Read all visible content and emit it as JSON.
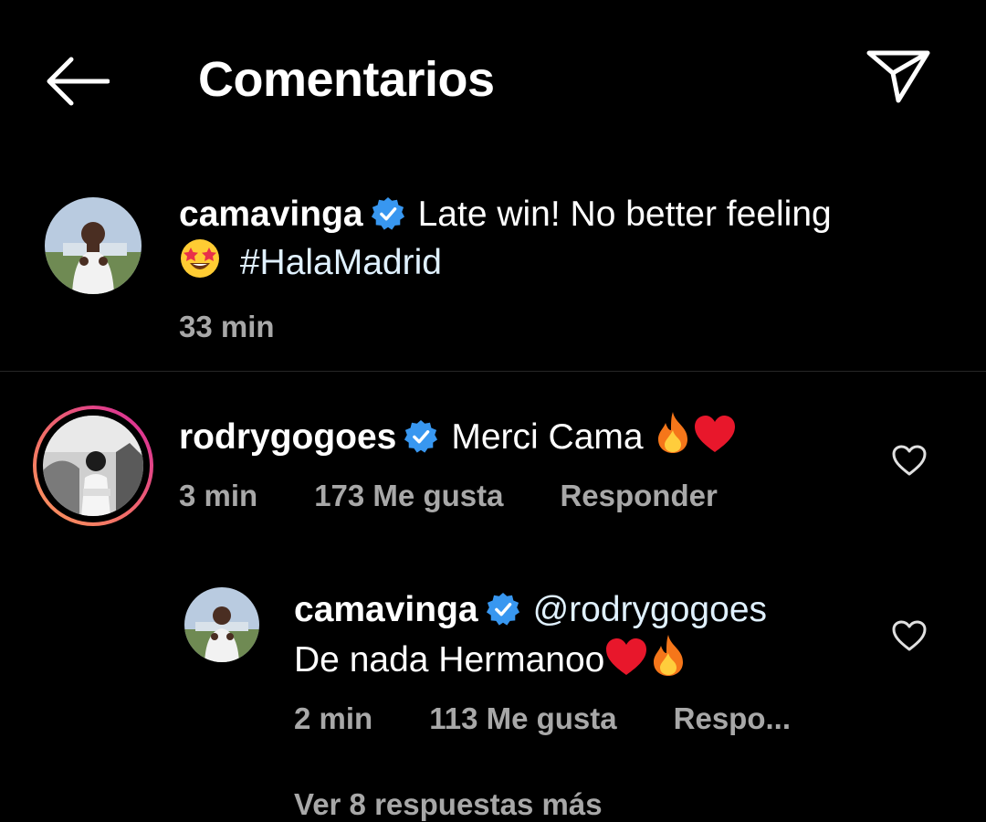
{
  "header": {
    "title": "Comentarios",
    "back_icon": "arrow-left-icon",
    "share_icon": "paper-plane-icon"
  },
  "caption": {
    "username": "camavinga",
    "text_part1": "Late win! No better feeling",
    "hashtag": "#HalaMadrid",
    "time": "33 min"
  },
  "comment": {
    "username": "rodrygogoes",
    "text": "Merci Cama ",
    "time": "3 min",
    "likes": "173 Me gusta",
    "reply_label": "Responder"
  },
  "reply": {
    "username": "camavinga",
    "mention": "@rodrygogoes",
    "text": "De nada Hermanoo",
    "time": "2 min",
    "likes": "113 Me gusta",
    "reply_label": "Respo..."
  },
  "footer_partial": "Ver 8 respuestas más",
  "colors": {
    "background": "#000000",
    "verified_blue": "#3897f0",
    "meta_gray": "#a8a8a8",
    "story_ring_start": "#d6249f",
    "story_ring_end": "#fd9a5a"
  }
}
